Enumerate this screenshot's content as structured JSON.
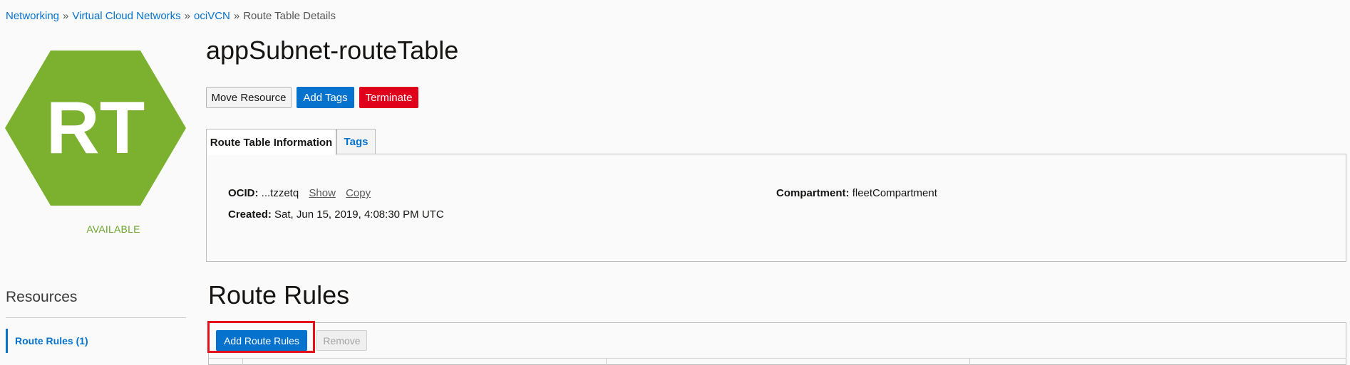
{
  "breadcrumb": {
    "items": [
      "Networking",
      "Virtual Cloud Networks",
      "ociVCN"
    ],
    "separator": "»",
    "current": "Route Table Details"
  },
  "resource_icon": {
    "text": "RT",
    "color": "#7bb12f",
    "icon": "hexagon-icon"
  },
  "state": "AVAILABLE",
  "title": "appSubnet-routeTable",
  "actions": {
    "move": "Move Resource",
    "add_tags": "Add Tags",
    "terminate": "Terminate"
  },
  "tabs": [
    {
      "label": "Route Table Information",
      "active": true
    },
    {
      "label": "Tags",
      "active": false
    }
  ],
  "info": {
    "ocid_label": "OCID:",
    "ocid_value": "...tzzetq",
    "show": "Show",
    "copy": "Copy",
    "created_label": "Created:",
    "created_value": "Sat, Jun 15, 2019, 4:08:30 PM UTC",
    "compartment_label": "Compartment:",
    "compartment_value": "fleetCompartment"
  },
  "resources": {
    "heading": "Resources",
    "items": [
      {
        "label": "Route Rules (1)",
        "active": true
      }
    ]
  },
  "route_rules": {
    "heading": "Route Rules",
    "add_button": "Add Route Rules",
    "remove_button": "Remove"
  },
  "colors": {
    "primary": "#0572ce",
    "danger": "#e0001b",
    "available": "#6aa52d",
    "highlight": "#e3101c"
  }
}
